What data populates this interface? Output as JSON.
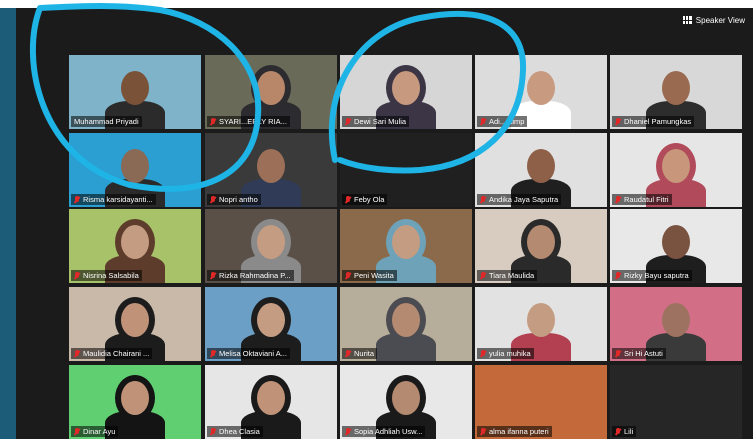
{
  "window": {
    "speaker_view_label": "Speaker View"
  },
  "colors": {
    "annotation_circle": "#1fb4e6",
    "active_border": "#e6d84c",
    "mic_muted": "#e02828"
  },
  "participants": [
    {
      "name": "Muhammad Priyadi",
      "muted": false,
      "active": true,
      "bg": "#7fb3c9",
      "skin": "#7a5238",
      "cloth": "#2b2b2b",
      "hijab": false
    },
    {
      "name": "SYARI...ERLY RIA...",
      "muted": true,
      "active": false,
      "bg": "#6a6a58",
      "skin": "#b8876a",
      "cloth": "#2c2c30",
      "hijab": true
    },
    {
      "name": "Dewi Sari Mulia",
      "muted": true,
      "active": false,
      "bg": "#d6d6d6",
      "skin": "#c79a80",
      "cloth": "#3b3545",
      "hijab": true
    },
    {
      "name": "Adi...atimp",
      "muted": true,
      "active": false,
      "bg": "#dcdcdc",
      "skin": "#c89a80",
      "cloth": "#ffffff",
      "hijab": false
    },
    {
      "name": "Dhaniel Pamungkas",
      "muted": true,
      "active": false,
      "bg": "#d8d8d8",
      "skin": "#9a6a50",
      "cloth": "#2d2d2d",
      "hijab": false
    },
    {
      "name": "Risma karsidayanti...",
      "muted": true,
      "active": false,
      "bg": "#2b9fd2",
      "skin": "#8a6a55",
      "cloth": "#2a2a2a",
      "hijab": false
    },
    {
      "name": "Nopri antho",
      "muted": true,
      "active": false,
      "bg": "#3a3a3a",
      "skin": "#9c7058",
      "cloth": "#2f3b57",
      "hijab": false
    },
    {
      "name": "Feby Ola",
      "muted": true,
      "active": false,
      "bg": "#202020",
      "skin": "#202020",
      "cloth": "#202020",
      "hijab": false
    },
    {
      "name": "Andika Jaya Saputra",
      "muted": true,
      "active": false,
      "bg": "#e0e0e0",
      "skin": "#8e6048",
      "cloth": "#1f1f1f",
      "hijab": false
    },
    {
      "name": "Raudatul Fitri",
      "muted": true,
      "active": false,
      "bg": "#e6e6e6",
      "skin": "#c8967a",
      "cloth": "#b14a5a",
      "hijab": true
    },
    {
      "name": "Nisrina Salsabila",
      "muted": true,
      "active": false,
      "bg": "#a8c26a",
      "skin": "#c49c82",
      "cloth": "#5e3c2c",
      "hijab": true
    },
    {
      "name": "Rizka Rahmadina P...",
      "muted": true,
      "active": false,
      "bg": "#5a5048",
      "skin": "#c49c82",
      "cloth": "#8a8a8a",
      "hijab": true
    },
    {
      "name": "Peni Wasita",
      "muted": true,
      "active": false,
      "bg": "#8a6a4a",
      "skin": "#c49c82",
      "cloth": "#6da2b8",
      "hijab": true
    },
    {
      "name": "Tiara Maulida",
      "muted": true,
      "active": false,
      "bg": "#d8ccc0",
      "skin": "#b48a70",
      "cloth": "#2a2a2a",
      "hijab": true
    },
    {
      "name": "Rizky Bayu saputra",
      "muted": true,
      "active": false,
      "bg": "#e8e8e8",
      "skin": "#7a5240",
      "cloth": "#1e1e1e",
      "hijab": false
    },
    {
      "name": "Maulidia Chairani ...",
      "muted": true,
      "active": false,
      "bg": "#c9b9a8",
      "skin": "#c09378",
      "cloth": "#1c1c1c",
      "hijab": true
    },
    {
      "name": "Melisa Oktaviani A...",
      "muted": true,
      "active": false,
      "bg": "#6b9fc6",
      "skin": "#c49c82",
      "cloth": "#1d1d1d",
      "hijab": true
    },
    {
      "name": "Nurita",
      "muted": true,
      "active": false,
      "bg": "#b6ad9a",
      "skin": "#b48a70",
      "cloth": "#4b4b52",
      "hijab": true
    },
    {
      "name": "yulia muhika",
      "muted": true,
      "active": false,
      "bg": "#e2e2e2",
      "skin": "#c49c82",
      "cloth": "#b34050",
      "hijab": false
    },
    {
      "name": "Sri Hi Astuti",
      "muted": true,
      "active": false,
      "bg": "#d26f86",
      "skin": "#9e7260",
      "cloth": "#3a3a3a",
      "hijab": false
    },
    {
      "name": "Dinar Ayu",
      "muted": true,
      "active": false,
      "bg": "#5fcf72",
      "skin": "#c09378",
      "cloth": "#141414",
      "hijab": true
    },
    {
      "name": "Dhea Clasia",
      "muted": true,
      "active": false,
      "bg": "#e6e6e6",
      "skin": "#c09378",
      "cloth": "#1a1a1a",
      "hijab": true
    },
    {
      "name": "Sopia Adhliah Usw...",
      "muted": true,
      "active": false,
      "bg": "#e8e8e8",
      "skin": "#b48a70",
      "cloth": "#1a1a1a",
      "hijab": true
    },
    {
      "name": "alma ifanna puteri",
      "muted": true,
      "active": false,
      "bg": "#c46a3a",
      "skin": "#c46a3a",
      "cloth": "#c46a3a",
      "hijab": false
    },
    {
      "name": "Lili",
      "muted": true,
      "active": false,
      "bg": "#262626",
      "skin": "#262626",
      "cloth": "#262626",
      "hijab": false
    }
  ]
}
